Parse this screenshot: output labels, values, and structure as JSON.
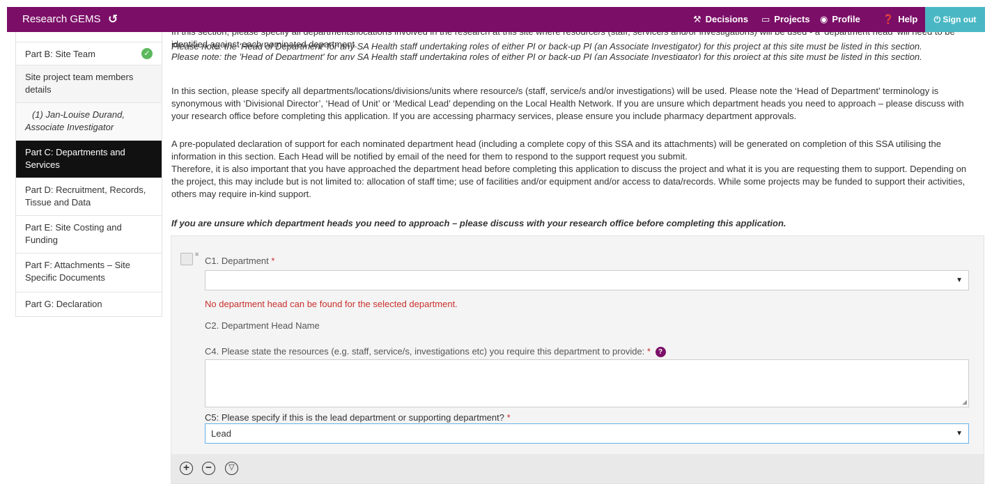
{
  "nav": {
    "brand": "Research GEMS",
    "refresh_icon": "refresh-icon",
    "links": [
      {
        "label": "Decisions",
        "icon": "gavel-icon"
      },
      {
        "label": "Projects",
        "icon": "monitor-icon"
      },
      {
        "label": "Profile",
        "icon": "user-circle-icon"
      },
      {
        "label": "Help",
        "icon": "question-circle-icon"
      }
    ],
    "signout": "Sign out",
    "colors": {
      "bar": "#7b0f67",
      "signout": "#4ab8c4"
    }
  },
  "sidebar": {
    "items": [
      {
        "label": "Part B: Site Team"
      },
      {
        "label": "Site project team members details"
      },
      {
        "label": "(1) Jan-Louise Durand, Associate Investigator"
      },
      {
        "label": "Part C: Departments and Services"
      },
      {
        "label": "Part D: Recruitment, Records, Tissue and Data"
      },
      {
        "label": "Part E: Site Costing and Funding"
      },
      {
        "label": "Part F: Attachments – Site Specific Documents"
      },
      {
        "label": "Part G: Declaration"
      }
    ]
  },
  "intro": {
    "p1a": "In this section, please specify all departments/locations involved in the research at this site where resource/s (staff, service/s and/or investigations) will be used - a 'department head' will need to be identified against each nominated department.",
    "p1b": "Please note: the 'Head of Department' for any SA Health staff undertaking roles of either PI or back-up PI (an Associate Investigator) for this project at this site must be listed in this section.",
    "p2": "In this section, please specify all departments/locations/divisions/units where resource/s (staff, service/s and/or investigations) will be used. Please note the ‘Head of Department’ terminology is synonymous with ‘Divisional Director’, ‘Head of Unit’ or ‘Medical Lead’ depending on the Local Health Network. If you are unsure which department heads you need to approach – please discuss with your research office before completing this application. If you are accessing pharmacy services, please ensure you include pharmacy department approvals.",
    "p3a": "A pre-populated declaration of support for each nominated department head (including a complete copy of this SSA and its attachments) will be generated on completion of this SSA utilising the information in this section. Each Head will be notified by email of the need for them to respond to the support request you submit.",
    "p3b": "Therefore, it is also important that you have approached the department head before completing this application to discuss the project and what it is you are requesting them to support. Depending on the project, this may include but is not limited to: allocation of staff time; use of facilities and/or equipment and/or access to data/records. While some projects may be funded to support their activities, others may require in-kind support.",
    "p4": "If you are unsure which department heads you need to approach – please discuss with your research office before completing this application."
  },
  "form": {
    "c1_label": "C1. Department",
    "c1_value": "",
    "error": "No department head can be found for the selected department.",
    "c2_label": "C2. Department Head Name",
    "c4_label": "C4. Please state the resources (e.g. staff, service/s, investigations etc) you require this department to provide:",
    "c5_label": "C5: Please specify if this is the lead department or supporting department?",
    "c5_value": "Lead",
    "required_mark": "*",
    "help_mark": "?"
  }
}
